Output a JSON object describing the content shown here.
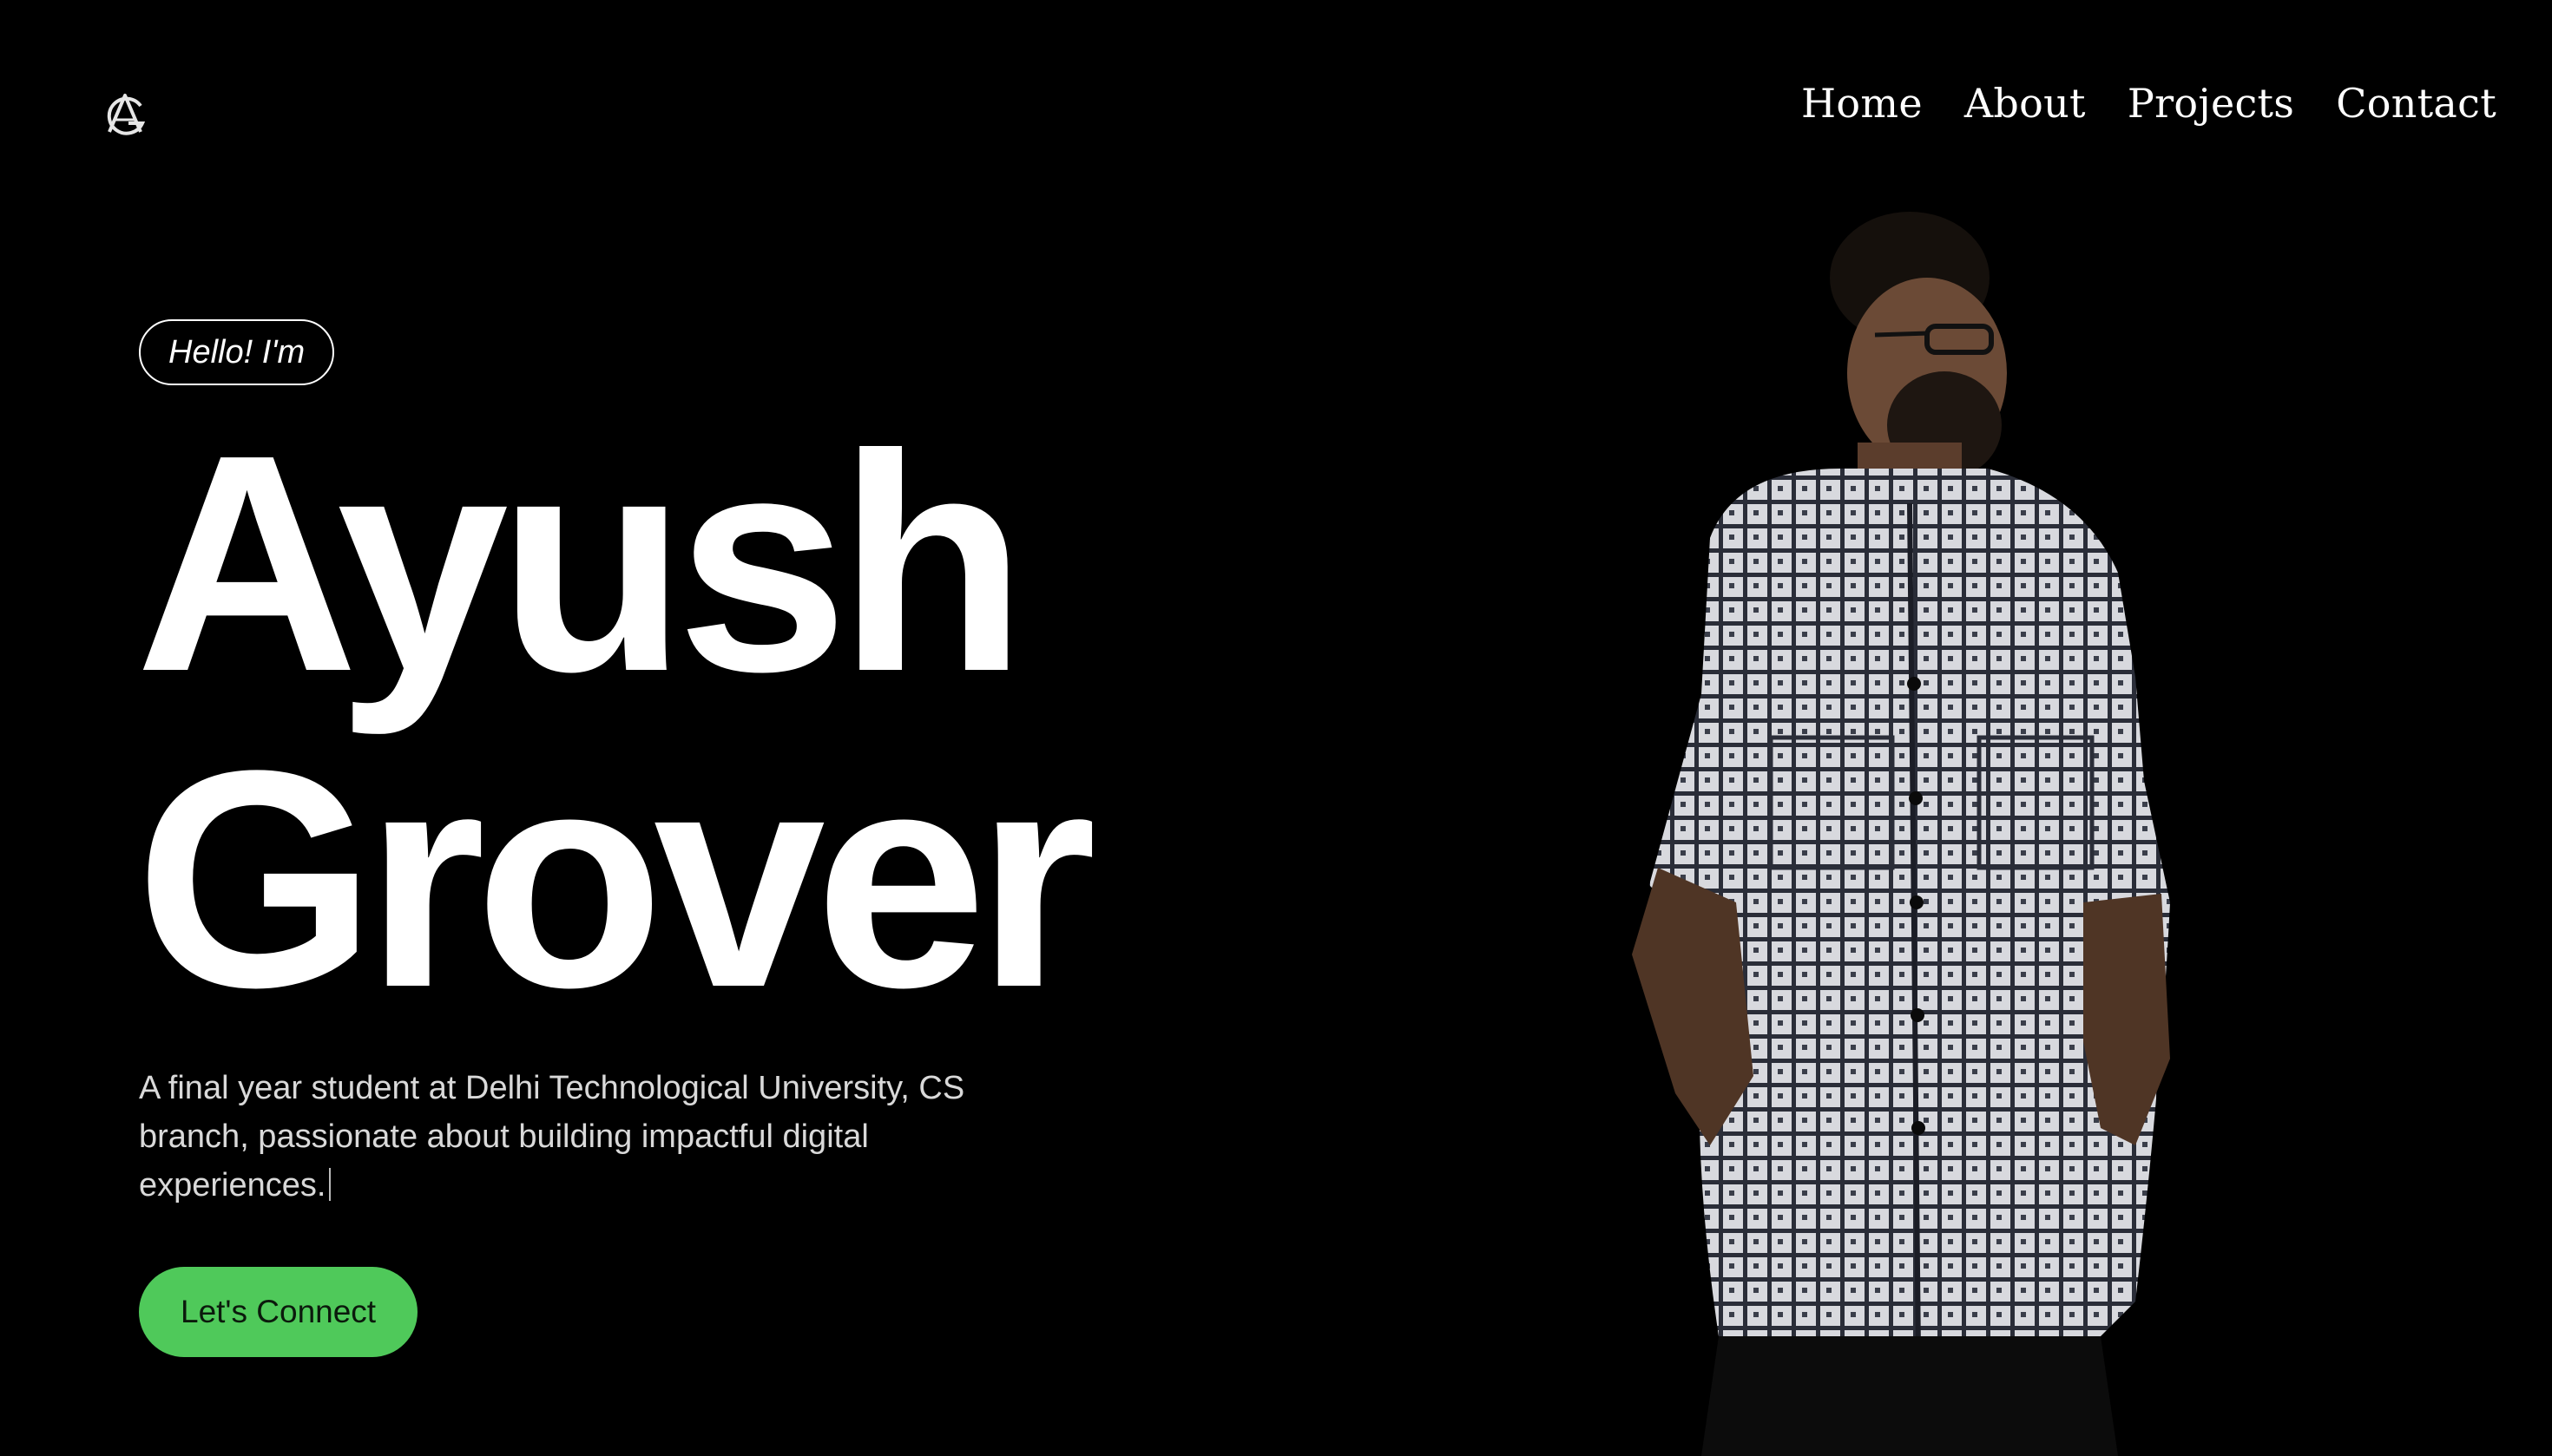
{
  "header": {
    "logo_icon": "ag-monogram-icon",
    "nav": [
      {
        "label": "Home"
      },
      {
        "label": "About"
      },
      {
        "label": "Projects"
      },
      {
        "label": "Contact"
      }
    ]
  },
  "hero": {
    "greeting": "Hello! I'm",
    "first_name": "Ayush",
    "last_name": "Grover",
    "description": "A final year student at Delhi Technological University, CS branch, passionate about building impactful digital experiences.",
    "cta_label": "Let's Connect"
  },
  "colors": {
    "background": "#000000",
    "text": "#ffffff",
    "accent": "#4fc95a"
  },
  "portrait": {
    "icon": "person-portrait-icon"
  }
}
